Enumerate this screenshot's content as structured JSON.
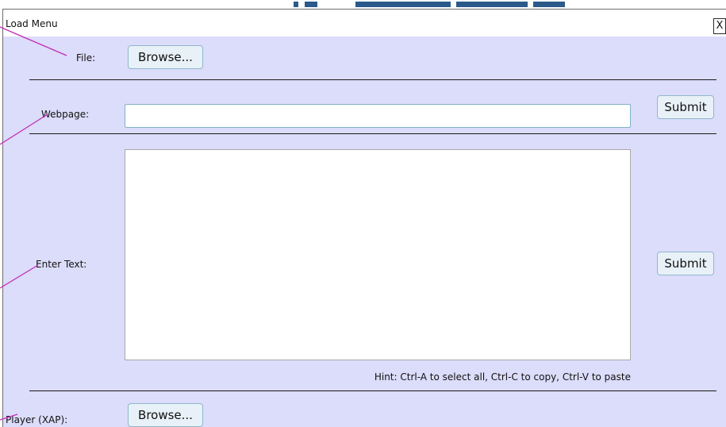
{
  "window": {
    "title": "Load Menu",
    "close_label": "X"
  },
  "file_row": {
    "label": "File:",
    "browse_label": "Browse..."
  },
  "webpage_row": {
    "label": "Webpage:",
    "input_value": "",
    "submit_label": "Submit"
  },
  "text_row": {
    "label": "Enter Text:",
    "textarea_value": "",
    "submit_label": "Submit",
    "hint": "Hint: Ctrl-A to select all, Ctrl-C to copy, Ctrl-V to paste"
  },
  "player_row": {
    "label": "Player (XAP):",
    "browse_label": "Browse..."
  },
  "colors": {
    "panel_bg": "#dcdcfb",
    "button_bg": "#e8f1f7",
    "button_border": "#8fb8cc",
    "annotation_line": "#c02fb4"
  }
}
